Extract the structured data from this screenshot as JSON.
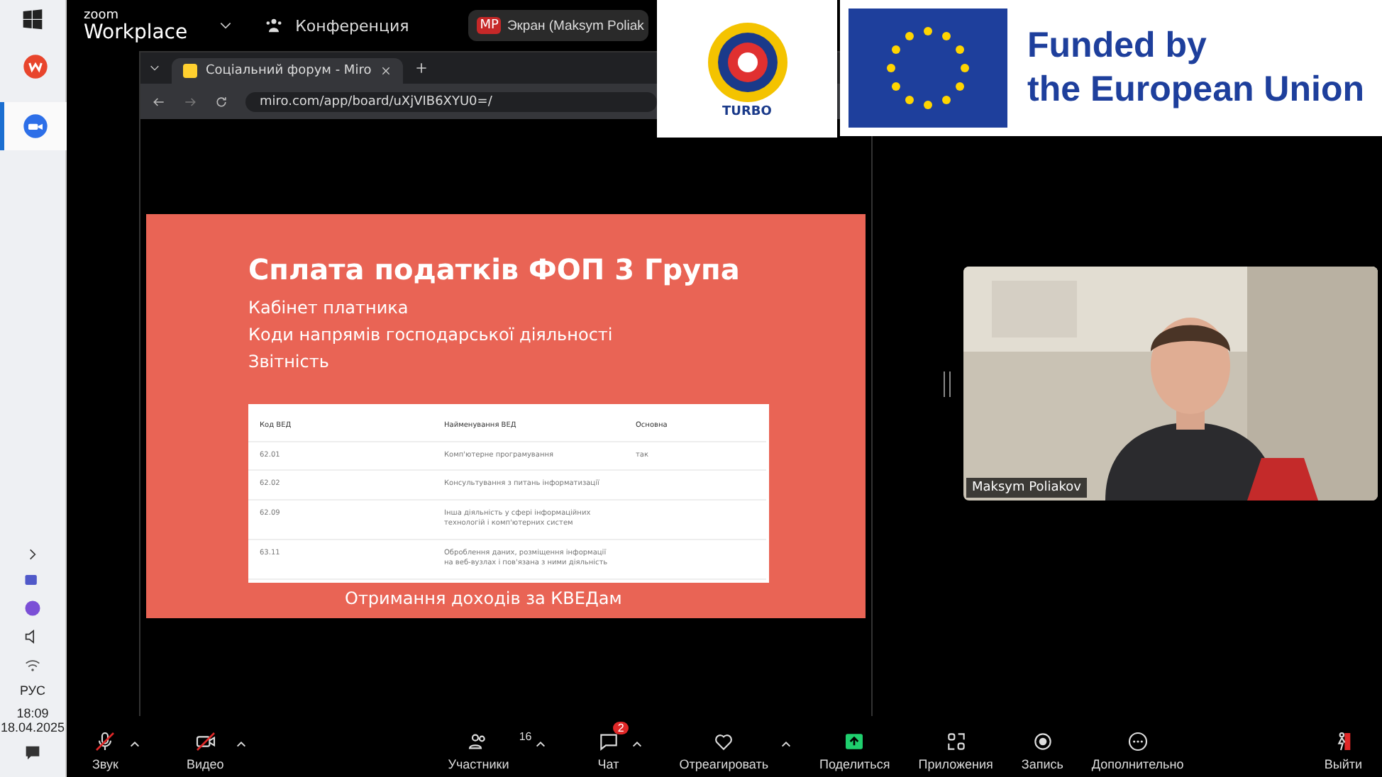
{
  "taskbar": {
    "apps": [
      {
        "kind": "wps",
        "selected": false
      },
      {
        "kind": "zoom",
        "selected": true
      }
    ],
    "tray": {
      "language": "РУС",
      "time": "18:09",
      "date": "18.04.2025"
    }
  },
  "zoom_header": {
    "brand_small": "zoom",
    "brand": "Workplace",
    "meeting": "Конференция",
    "share_badge": "MP",
    "share_label": "Экран (Maksym Poliak"
  },
  "browser": {
    "tab_title": "Соціальний форум - Miro",
    "url": "miro.com/app/board/uXjVIB6XYU0=/"
  },
  "slide": {
    "title": "Сплата податків ФОП 3 Група",
    "lines": [
      "Кабінет платника",
      "Коди напрямів господарської діяльності",
      "Звітність"
    ],
    "table": {
      "columns": [
        "Код ВЕД",
        "Найменування ВЕД",
        "Основна"
      ],
      "rows": [
        [
          "62.01",
          "Комп'ютерне програмування",
          "так"
        ],
        [
          "62.02",
          "Консультування з питань інформатизації",
          ""
        ],
        [
          "62.09",
          "Інша діяльність у сфері інформаційних технологій і комп'ютерних систем",
          ""
        ],
        [
          "63.11",
          "Оброблення даних, розміщення інформації на веб-вузлах і пов'язана з ними діяльність",
          ""
        ]
      ]
    },
    "footer": "Отримання доходів за КВЕДам"
  },
  "video": {
    "name": "Maksym Poliakov"
  },
  "banner": {
    "logo_text": "TURBO",
    "lines": [
      "Funded by",
      "the European Union"
    ]
  },
  "toolbar": [
    {
      "kind": "audio",
      "label": "Звук",
      "muted": true,
      "caret": true
    },
    {
      "kind": "video",
      "label": "Видео",
      "muted": true,
      "caret": true
    },
    {
      "kind": "participants",
      "label": "Участники",
      "count": "16",
      "caret": true
    },
    {
      "kind": "chat",
      "label": "Чат",
      "badge": "2",
      "caret": true
    },
    {
      "kind": "react",
      "label": "Отреагировать",
      "caret": true
    },
    {
      "kind": "share",
      "label": "Поделиться",
      "caret": false
    },
    {
      "kind": "apps",
      "label": "Приложения",
      "caret": false
    },
    {
      "kind": "record",
      "label": "Запись",
      "caret": false
    },
    {
      "kind": "more",
      "label": "Дополнительно",
      "caret": false
    },
    {
      "kind": "leave",
      "label": "Выйти",
      "caret": false
    }
  ]
}
